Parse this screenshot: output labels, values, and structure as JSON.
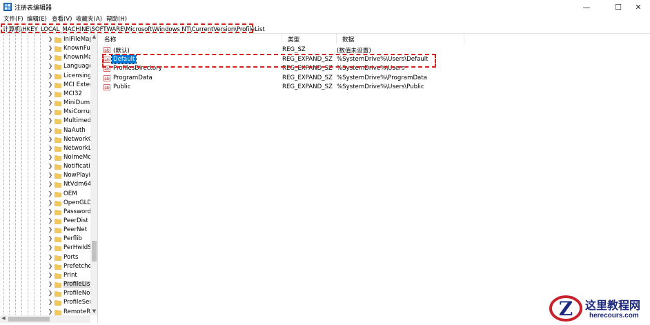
{
  "window": {
    "title": "注册表编辑器",
    "minimize_glyph": "—",
    "maximize_glyph": "☐",
    "close_glyph": "✕"
  },
  "menu": [
    "文件(F)",
    "编辑(E)",
    "查看(V)",
    "收藏夹(A)",
    "帮助(H)"
  ],
  "address": "计算机\\HKEY_LOCAL_MACHINE\\SOFTWARE\\Microsoft\\Windows NT\\CurrentVersion\\ProfileList",
  "tree": {
    "items": [
      {
        "label": "IniFileMap"
      },
      {
        "label": "KnownFun"
      },
      {
        "label": "KnownMa"
      },
      {
        "label": "Language"
      },
      {
        "label": "LicensingD"
      },
      {
        "label": "MCI Exten"
      },
      {
        "label": "MCI32"
      },
      {
        "label": "MiniDump"
      },
      {
        "label": "MsiCorrup"
      },
      {
        "label": "Multimedi"
      },
      {
        "label": "NaAuth"
      },
      {
        "label": "NetworkC"
      },
      {
        "label": "NetworkLi"
      },
      {
        "label": "NoImeMo"
      },
      {
        "label": "Notificatio"
      },
      {
        "label": "NowPlayin"
      },
      {
        "label": "NtVdm64"
      },
      {
        "label": "OEM"
      },
      {
        "label": "OpenGLDr"
      },
      {
        "label": "PasswordL"
      },
      {
        "label": "PeerDist"
      },
      {
        "label": "PeerNet"
      },
      {
        "label": "Perflib"
      },
      {
        "label": "PerHwIdSt"
      },
      {
        "label": "Ports"
      },
      {
        "label": "Prefetcher"
      },
      {
        "label": "Print"
      },
      {
        "label": "ProfileList"
      },
      {
        "label": "ProfileNot"
      },
      {
        "label": "ProfileServ"
      },
      {
        "label": "RemoteRe"
      }
    ]
  },
  "columns": {
    "name": "名称",
    "type": "类型",
    "data": "数据"
  },
  "rows": [
    {
      "name": "(默认)",
      "type": "REG_SZ",
      "data": "(数值未设置)"
    },
    {
      "name": "Default",
      "type": "REG_EXPAND_SZ",
      "data": "%SystemDrive%\\Users\\Default"
    },
    {
      "name": "ProfilesDirectory",
      "type": "REG_EXPAND_SZ",
      "data": "%SystemDrive%\\Users"
    },
    {
      "name": "ProgramData",
      "type": "REG_EXPAND_SZ",
      "data": "%SystemDrive%\\ProgramData"
    },
    {
      "name": "Public",
      "type": "REG_EXPAND_SZ",
      "data": "%SystemDrive%\\Users\\Public"
    }
  ],
  "watermark": {
    "title": "这里教程网",
    "url": "herecours.com",
    "logo_letter": "Z"
  },
  "colors": {
    "highlight_dash": "#d41f1f",
    "selection": "#0078d7",
    "folder": "#f1c85b",
    "watermark": "#1d2a80"
  },
  "icons": {
    "app": "registry-editor-icon",
    "tree_item": "folder-icon",
    "value": "string-value-icon"
  }
}
